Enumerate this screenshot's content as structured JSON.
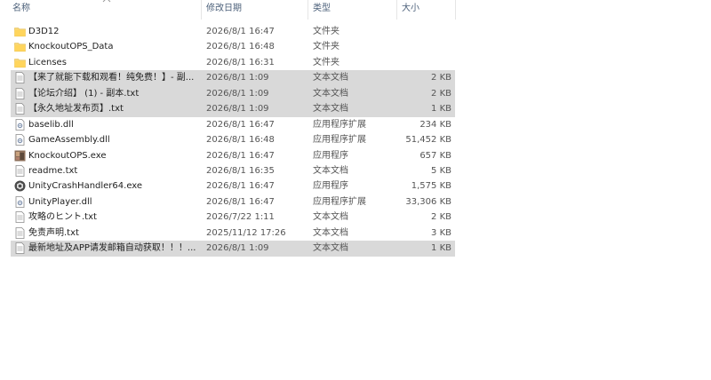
{
  "columns": {
    "name": "名称",
    "date": "修改日期",
    "type": "类型",
    "size": "大小"
  },
  "rows": [
    {
      "name": "D3D12",
      "date": "2026/8/1 16:47",
      "type": "文件夹",
      "size": "",
      "icon": "folder-icon",
      "selected": false
    },
    {
      "name": "KnockoutOPS_Data",
      "date": "2026/8/1 16:48",
      "type": "文件夹",
      "size": "",
      "icon": "folder-icon",
      "selected": false
    },
    {
      "name": "Licenses",
      "date": "2026/8/1 16:31",
      "type": "文件夹",
      "size": "",
      "icon": "folder-icon",
      "selected": false
    },
    {
      "name": "【来了就能下载和观看！纯免费！】- 副...",
      "date": "2026/8/1 1:09",
      "type": "文本文档",
      "size": "2 KB",
      "icon": "text-file-icon",
      "selected": true
    },
    {
      "name": "【论坛介绍】 (1) - 副本.txt",
      "date": "2026/8/1 1:09",
      "type": "文本文档",
      "size": "2 KB",
      "icon": "text-file-icon",
      "selected": true
    },
    {
      "name": "【永久地址发布页】.txt",
      "date": "2026/8/1 1:09",
      "type": "文本文档",
      "size": "1 KB",
      "icon": "text-file-icon",
      "selected": true
    },
    {
      "name": "baselib.dll",
      "date": "2026/8/1 16:47",
      "type": "应用程序扩展",
      "size": "234 KB",
      "icon": "dll-file-icon",
      "selected": false
    },
    {
      "name": "GameAssembly.dll",
      "date": "2026/8/1 16:48",
      "type": "应用程序扩展",
      "size": "51,452 KB",
      "icon": "dll-file-icon",
      "selected": false
    },
    {
      "name": "KnockoutOPS.exe",
      "date": "2026/8/1 16:47",
      "type": "应用程序",
      "size": "657 KB",
      "icon": "app-exe-icon",
      "selected": false
    },
    {
      "name": "readme.txt",
      "date": "2026/8/1 16:35",
      "type": "文本文档",
      "size": "5 KB",
      "icon": "text-file-icon",
      "selected": false
    },
    {
      "name": "UnityCrashHandler64.exe",
      "date": "2026/8/1 16:47",
      "type": "应用程序",
      "size": "1,575 KB",
      "icon": "unity-exe-icon",
      "selected": false
    },
    {
      "name": "UnityPlayer.dll",
      "date": "2026/8/1 16:47",
      "type": "应用程序扩展",
      "size": "33,306 KB",
      "icon": "dll-file-icon",
      "selected": false
    },
    {
      "name": "攻略のヒント.txt",
      "date": "2026/7/22 1:11",
      "type": "文本文档",
      "size": "2 KB",
      "icon": "text-file-icon",
      "selected": false
    },
    {
      "name": "免责声明.txt",
      "date": "2025/11/12 17:26",
      "type": "文本文档",
      "size": "3 KB",
      "icon": "text-file-icon",
      "selected": false
    },
    {
      "name": "最新地址及APP请发邮箱自动获取！！！...",
      "date": "2026/8/1 1:09",
      "type": "文本文档",
      "size": "1 KB",
      "icon": "text-file-icon",
      "selected": true
    }
  ]
}
